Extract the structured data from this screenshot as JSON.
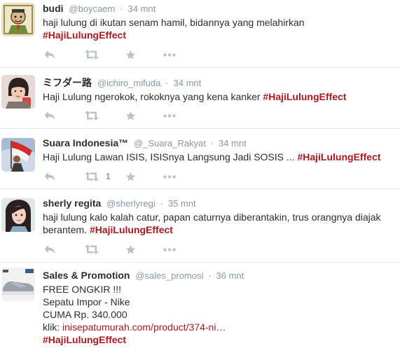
{
  "tweets": [
    {
      "fullname": "budi",
      "username": "@boycaem",
      "separator": "·",
      "time": "34 mnt",
      "text": "haji lulung di ikutan senam hamil, bidannya yang melahirkan",
      "hashtag": "#HajiLulungEffect",
      "actions": {
        "reply_icon": "reply-icon",
        "retweet_icon": "retweet-icon",
        "favorite_icon": "star-icon",
        "more_icon": "more-dots-icon",
        "retweet_count": ""
      }
    },
    {
      "fullname": "ミフダー路",
      "username": "@ichiro_mifuda",
      "separator": "·",
      "time": "34 mnt",
      "text": "Haji Lulung ngerokok, rokoknya yang kena kanker ",
      "hashtag": "#HajiLulungEffect",
      "actions": {
        "reply_icon": "reply-icon",
        "retweet_icon": "retweet-icon",
        "favorite_icon": "star-icon",
        "more_icon": "more-dots-icon",
        "retweet_count": ""
      }
    },
    {
      "fullname": "Suara Indonesia™",
      "username": "@_Suara_Rakyat",
      "separator": "·",
      "time": "34 mnt",
      "text": "Haji Lulung Lawan ISIS, ISISnya Langsung Jadi SOSIS ... ",
      "hashtag": "#HajiLulungEffect",
      "actions": {
        "reply_icon": "reply-icon",
        "retweet_icon": "retweet-icon",
        "favorite_icon": "star-icon",
        "more_icon": "more-dots-icon",
        "retweet_count": "1"
      }
    },
    {
      "fullname": "sherly regita",
      "username": "@sherlyregi",
      "separator": "·",
      "time": "35 mnt",
      "text": "haji lulung kalo kalah catur, papan caturnya diberantakin, trus orangnya diajak berantem. ",
      "hashtag": "#HajiLulungEffect",
      "actions": {
        "reply_icon": "reply-icon",
        "retweet_icon": "retweet-icon",
        "favorite_icon": "star-icon",
        "more_icon": "more-dots-icon",
        "retweet_count": ""
      }
    },
    {
      "fullname": "Sales & Promotion",
      "username": "@sales_promosi",
      "separator": "·",
      "time": "36 mnt",
      "lines": [
        "FREE ONGKIR !!!",
        "Sepatu Impor - Nike",
        "CUMA Rp. 340.000"
      ],
      "link_prefix": "klik: ",
      "link": "inisepatumurah.com/product/374-ni…",
      "hashtag": "#HajiLulungEffect"
    }
  ],
  "colors": {
    "hashtag": "#b0161c",
    "action_icon": "#b8c3cb",
    "meta_text": "#8899a6",
    "divider": "#e1e8ed"
  }
}
